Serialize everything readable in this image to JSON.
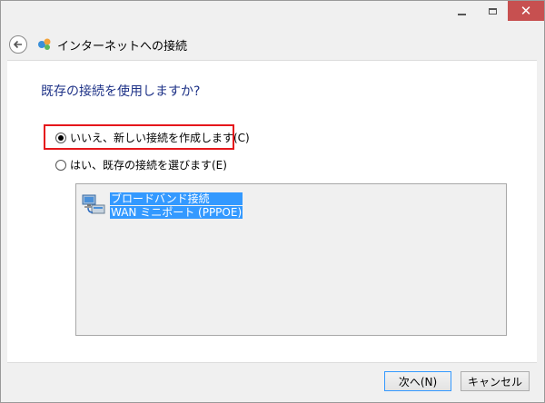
{
  "window": {
    "min_icon": "minimize-icon",
    "max_icon": "maximize-icon",
    "close_icon": "close-icon",
    "close_glyph": "✕",
    "close_color": "#c75050"
  },
  "nav": {
    "back_glyph": "←",
    "title": "インターネットへの接続"
  },
  "main": {
    "question": "既存の接続を使用しますか?",
    "option_new": "いいえ、新しい接続を作成します(C)",
    "option_existing": "はい、既存の接続を選びます(E)",
    "selected_option": "option_new",
    "highlight_color": "#e5171b",
    "connections": [
      {
        "lines": [
          "ブロードバンド接続",
          "WAN ミニポート (PPPOE)"
        ],
        "icon": "network-connection-icon"
      }
    ],
    "selection_color": "#3399ff"
  },
  "footer": {
    "next_label": "次へ(N)",
    "cancel_label": "キャンセル"
  }
}
